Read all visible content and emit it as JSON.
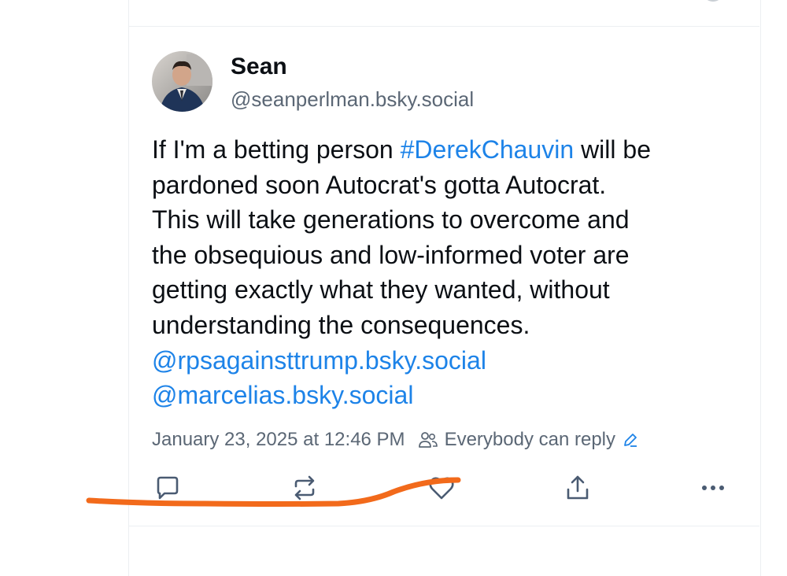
{
  "post": {
    "author_name": "Sean",
    "author_handle": "@seanperlman.bsky.social",
    "body": {
      "line1_pre": "If I'm a betting person ",
      "hashtag": "#DerekChauvin",
      "line1_post": " will be",
      "line2": "pardoned soon Autocrat's gotta Autocrat.",
      "line3": "This will take generations to overcome and",
      "line4": "the obsequious and low-informed voter are",
      "line5": "getting exactly what they wanted, without",
      "line6": "understanding the consequences.",
      "mention1": "@rpsagainsttrump.bsky.social",
      "mention2": "@marcelias.bsky.social"
    },
    "timestamp": "January 23, 2025 at 12:46 PM",
    "reply_setting": "Everybody can reply"
  },
  "actions": {
    "icons": [
      "reply-icon",
      "repost-icon",
      "like-icon",
      "share-icon",
      "more-icon"
    ]
  },
  "colors": {
    "link": "#1d83e8",
    "muted": "#5b6775",
    "text": "#0b0f14",
    "annotation": "#f26a1b"
  }
}
